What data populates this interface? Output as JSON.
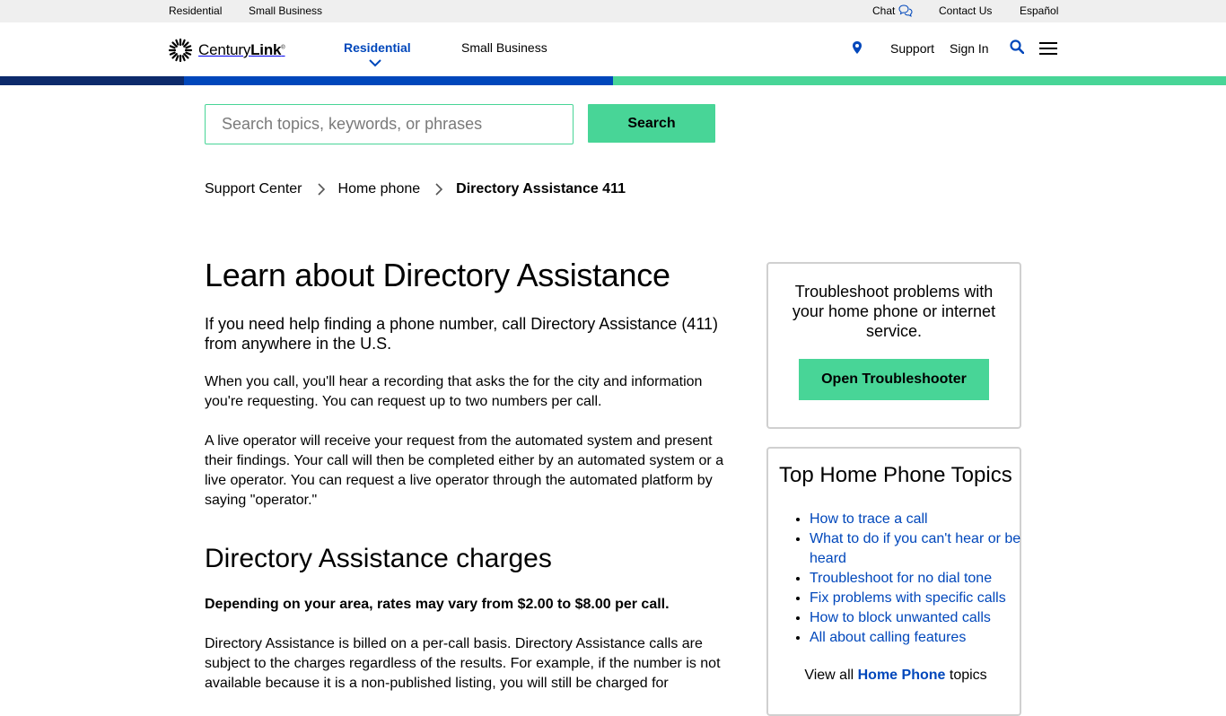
{
  "utility_nav": {
    "residential": "Residential",
    "small_business": "Small Business",
    "chat": "Chat",
    "contact_us": "Contact Us",
    "espanol": "Español"
  },
  "brand": {
    "name_light": "Century",
    "name_bold": "Link",
    "trademark": "®"
  },
  "main_nav": {
    "residential": "Residential",
    "small_business": "Small Business",
    "support": "Support",
    "sign_in": "Sign In"
  },
  "colors": {
    "brand_blue": "#0047bb",
    "dark_blue": "#0d2a6b",
    "brand_green": "#48d597"
  },
  "search": {
    "placeholder": "Search topics, keywords, or phrases",
    "value": "",
    "button_label": "Search"
  },
  "breadcrumb": {
    "items": [
      "Support Center",
      "Home phone"
    ],
    "current": "Directory Assistance 411"
  },
  "article": {
    "title": "Learn about Directory Assistance",
    "intro": "If you need help finding a phone number, call Directory Assistance (411) from anywhere in the U.S.",
    "p1": "When you call, you'll hear a recording that asks the for the city and information you're requesting. You can request up to two numbers per call.",
    "p2": "A live operator will receive your request from the automated system and present their findings. Your call will then be completed either by an automated system or a live operator. You can request a live operator through the automated platform by saying \"operator.\"",
    "charges_heading": "Directory Assistance charges",
    "charges_bold": "Depending on your area, rates may vary from $2.00 to $8.00 per call.",
    "charges_p": "Directory Assistance is billed on a per-call basis. Directory Assistance calls are subject to the charges regardless of the results. For example, if the number is not available because it is a non-published listing, you will still be charged for"
  },
  "troubleshooter_card": {
    "text": "Troubleshoot problems with your home phone or internet service.",
    "button_label": "Open Troubleshooter"
  },
  "topics_card": {
    "title": "Top Home Phone Topics",
    "topics": [
      "How to trace a call",
      "What to do if you can't hear or be heard",
      "Troubleshoot for no dial tone",
      "Fix problems with specific calls",
      "How to block unwanted calls",
      "All about calling features"
    ],
    "view_all_prefix": "View all",
    "view_all_link": "Home Phone",
    "view_all_suffix": "topics"
  },
  "icons": {
    "chat": "chat-bubbles-icon",
    "logo": "sunburst-logo-icon",
    "caret": "chevron-down-icon",
    "location": "location-pin-icon",
    "search": "search-icon",
    "menu": "hamburger-menu-icon",
    "breadcrumb_sep": "chevron-right-icon"
  }
}
